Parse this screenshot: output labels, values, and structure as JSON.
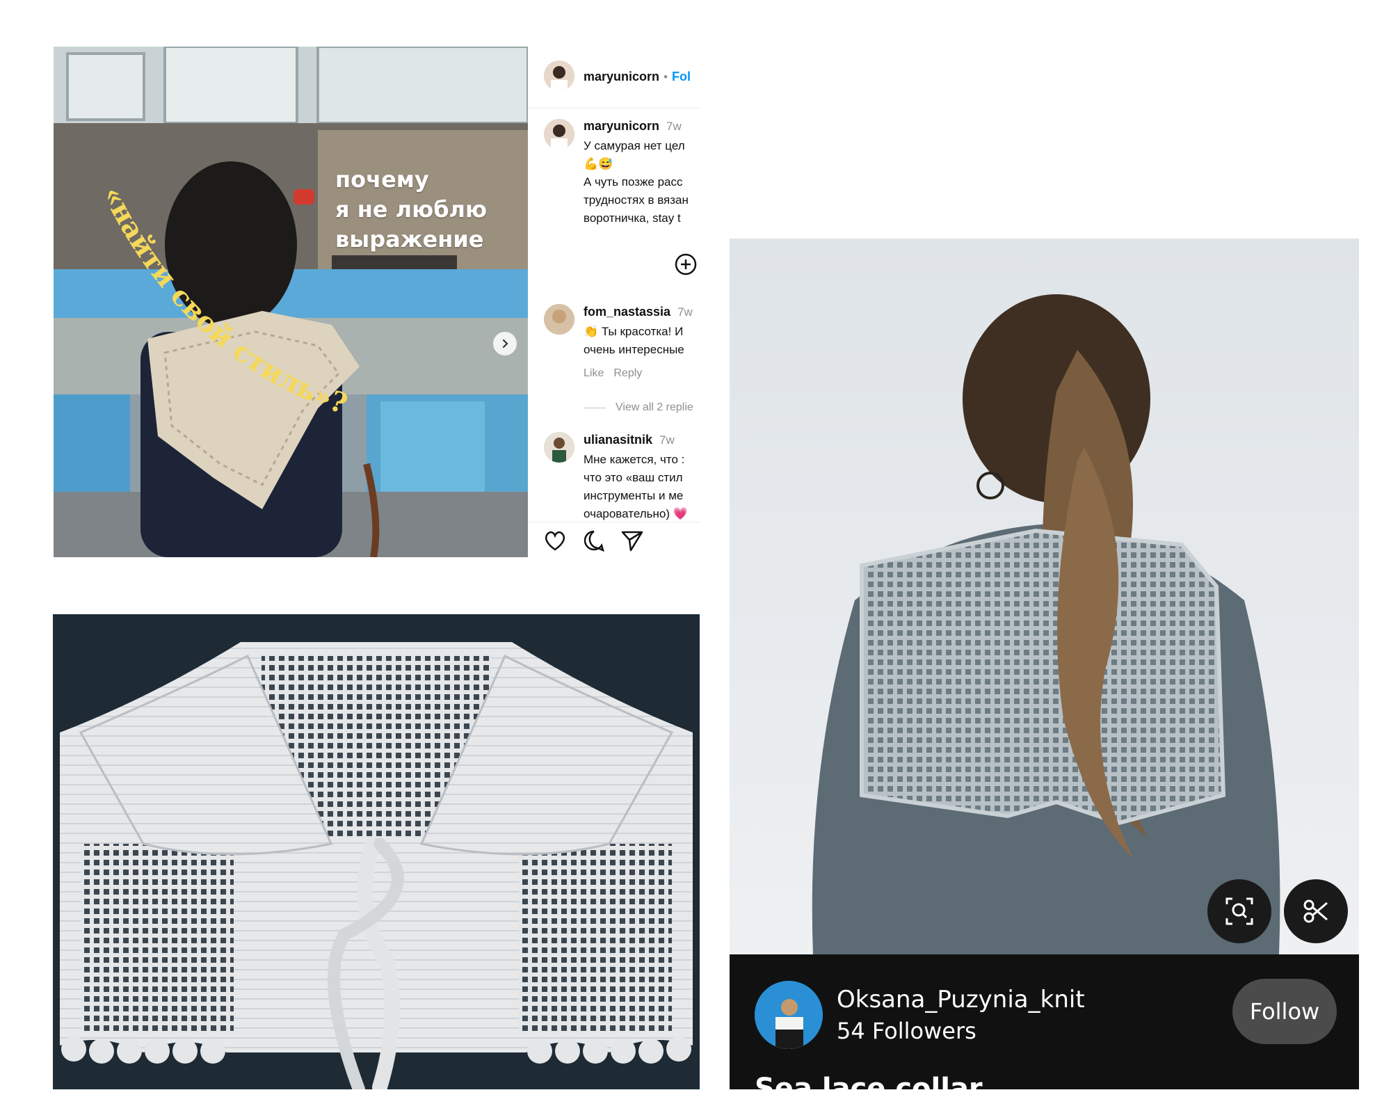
{
  "instagram": {
    "header": {
      "username": "maryunicorn",
      "separator": "•",
      "follow_label": "Fol"
    },
    "photo": {
      "caption_lines": "почему\nя не люблю\nвыражение",
      "arc_text": "«найти свой стиль»?",
      "next_icon": "chevron-right-icon"
    },
    "comments": [
      {
        "username": "maryunicorn",
        "time": "7w",
        "lines": [
          "У самурая нет цел",
          "💪😅",
          "",
          "А чуть позже расс",
          "трудностях в вязан",
          "воротничка, stay t"
        ]
      },
      {
        "username": "fom_nastassia",
        "time": "7w",
        "lines": [
          "👏 Ты красотка! И",
          "очень интересные"
        ],
        "like_label": "Like",
        "reply_label": "Reply",
        "view_replies_label": "View all 2 replie"
      },
      {
        "username": "ulianasitnik",
        "time": "7w",
        "lines": [
          "Мне кажется, что :",
          "что это «ваш стил",
          "инструменты и ме",
          "очаровательно) 💗"
        ]
      }
    ],
    "actions": {
      "like_icon": "heart-icon",
      "comment_icon": "comment-icon",
      "share_icon": "send-icon",
      "add_icon": "plus-circle-icon"
    }
  },
  "pin": {
    "username": "Oksana_Puzynia_knit",
    "followers": "54 Followers",
    "follow_label": "Follow",
    "title": "Sea lace collar",
    "lens_icon": "visual-search-icon",
    "cut_icon": "scissors-icon"
  }
}
